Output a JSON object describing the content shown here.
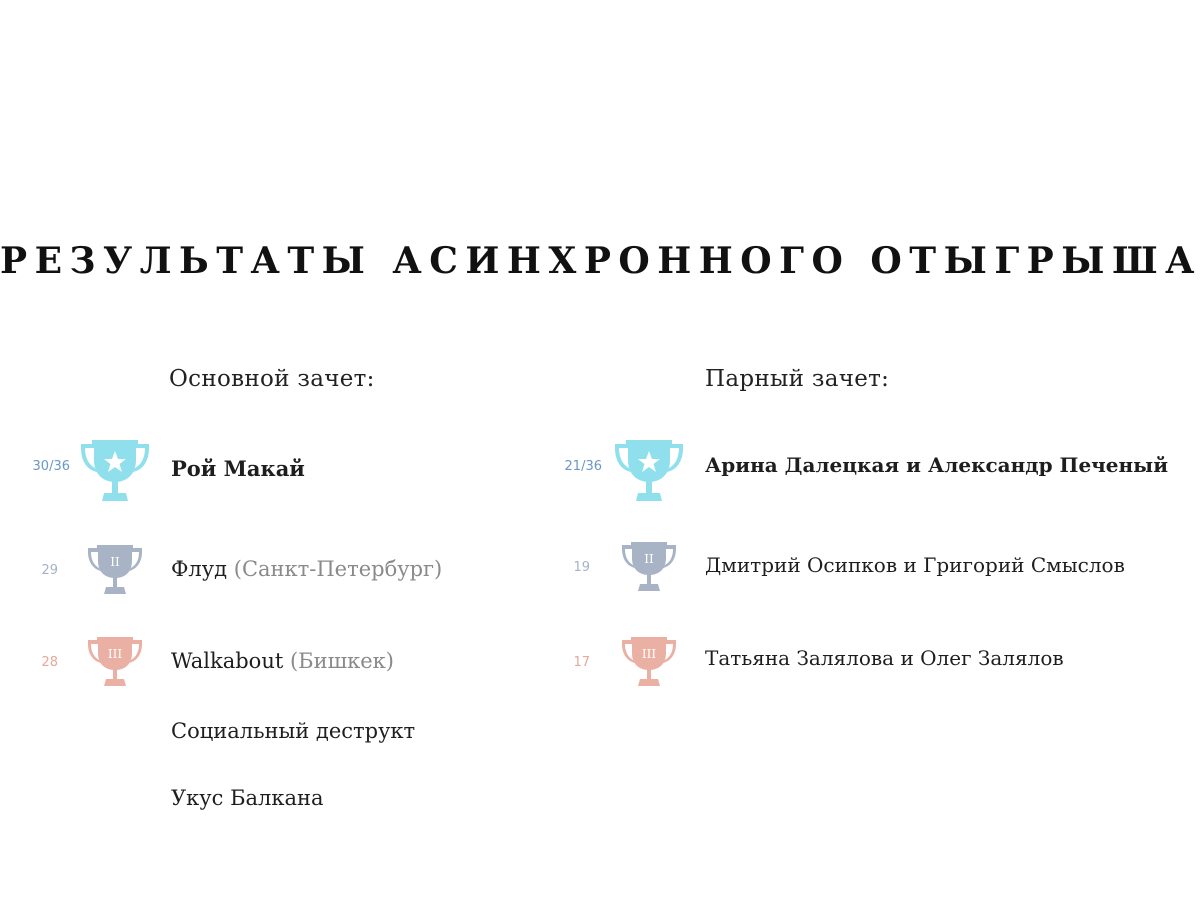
{
  "title": "РЕЗУЛЬТАТЫ АСИНХРОННОГО ОТЫГРЫША",
  "main": {
    "heading": "Основной зачет:",
    "places": [
      {
        "score": "30/36",
        "name": "Рой Макай",
        "city": "",
        "rank": "gold"
      },
      {
        "score": "29",
        "name": "Флуд",
        "city": "(Санкт-Петербург)",
        "rank": "silver",
        "numeral": "II"
      },
      {
        "score": "28",
        "name": "Walkabout",
        "city": "(Бишкек)",
        "rank": "bronze",
        "numeral": "III"
      }
    ],
    "others": [
      "Социальный деструкт",
      "Укус Балкана"
    ]
  },
  "pairs": {
    "heading": "Парный зачет:",
    "places": [
      {
        "score": "21/36",
        "name": "Арина Далецкая и Александр Печеный",
        "rank": "gold"
      },
      {
        "score": "19",
        "name": "Дмитрий Осипков и Григорий Смыслов",
        "rank": "silver",
        "numeral": "II"
      },
      {
        "score": "17",
        "name": "Татьяна Залялова и Олег Залялов",
        "rank": "bronze",
        "numeral": "III"
      }
    ]
  },
  "colors": {
    "gold_cup": "#8fe0ec",
    "silver_cup": "#a9b3c6",
    "bronze_cup": "#eab0a3"
  }
}
